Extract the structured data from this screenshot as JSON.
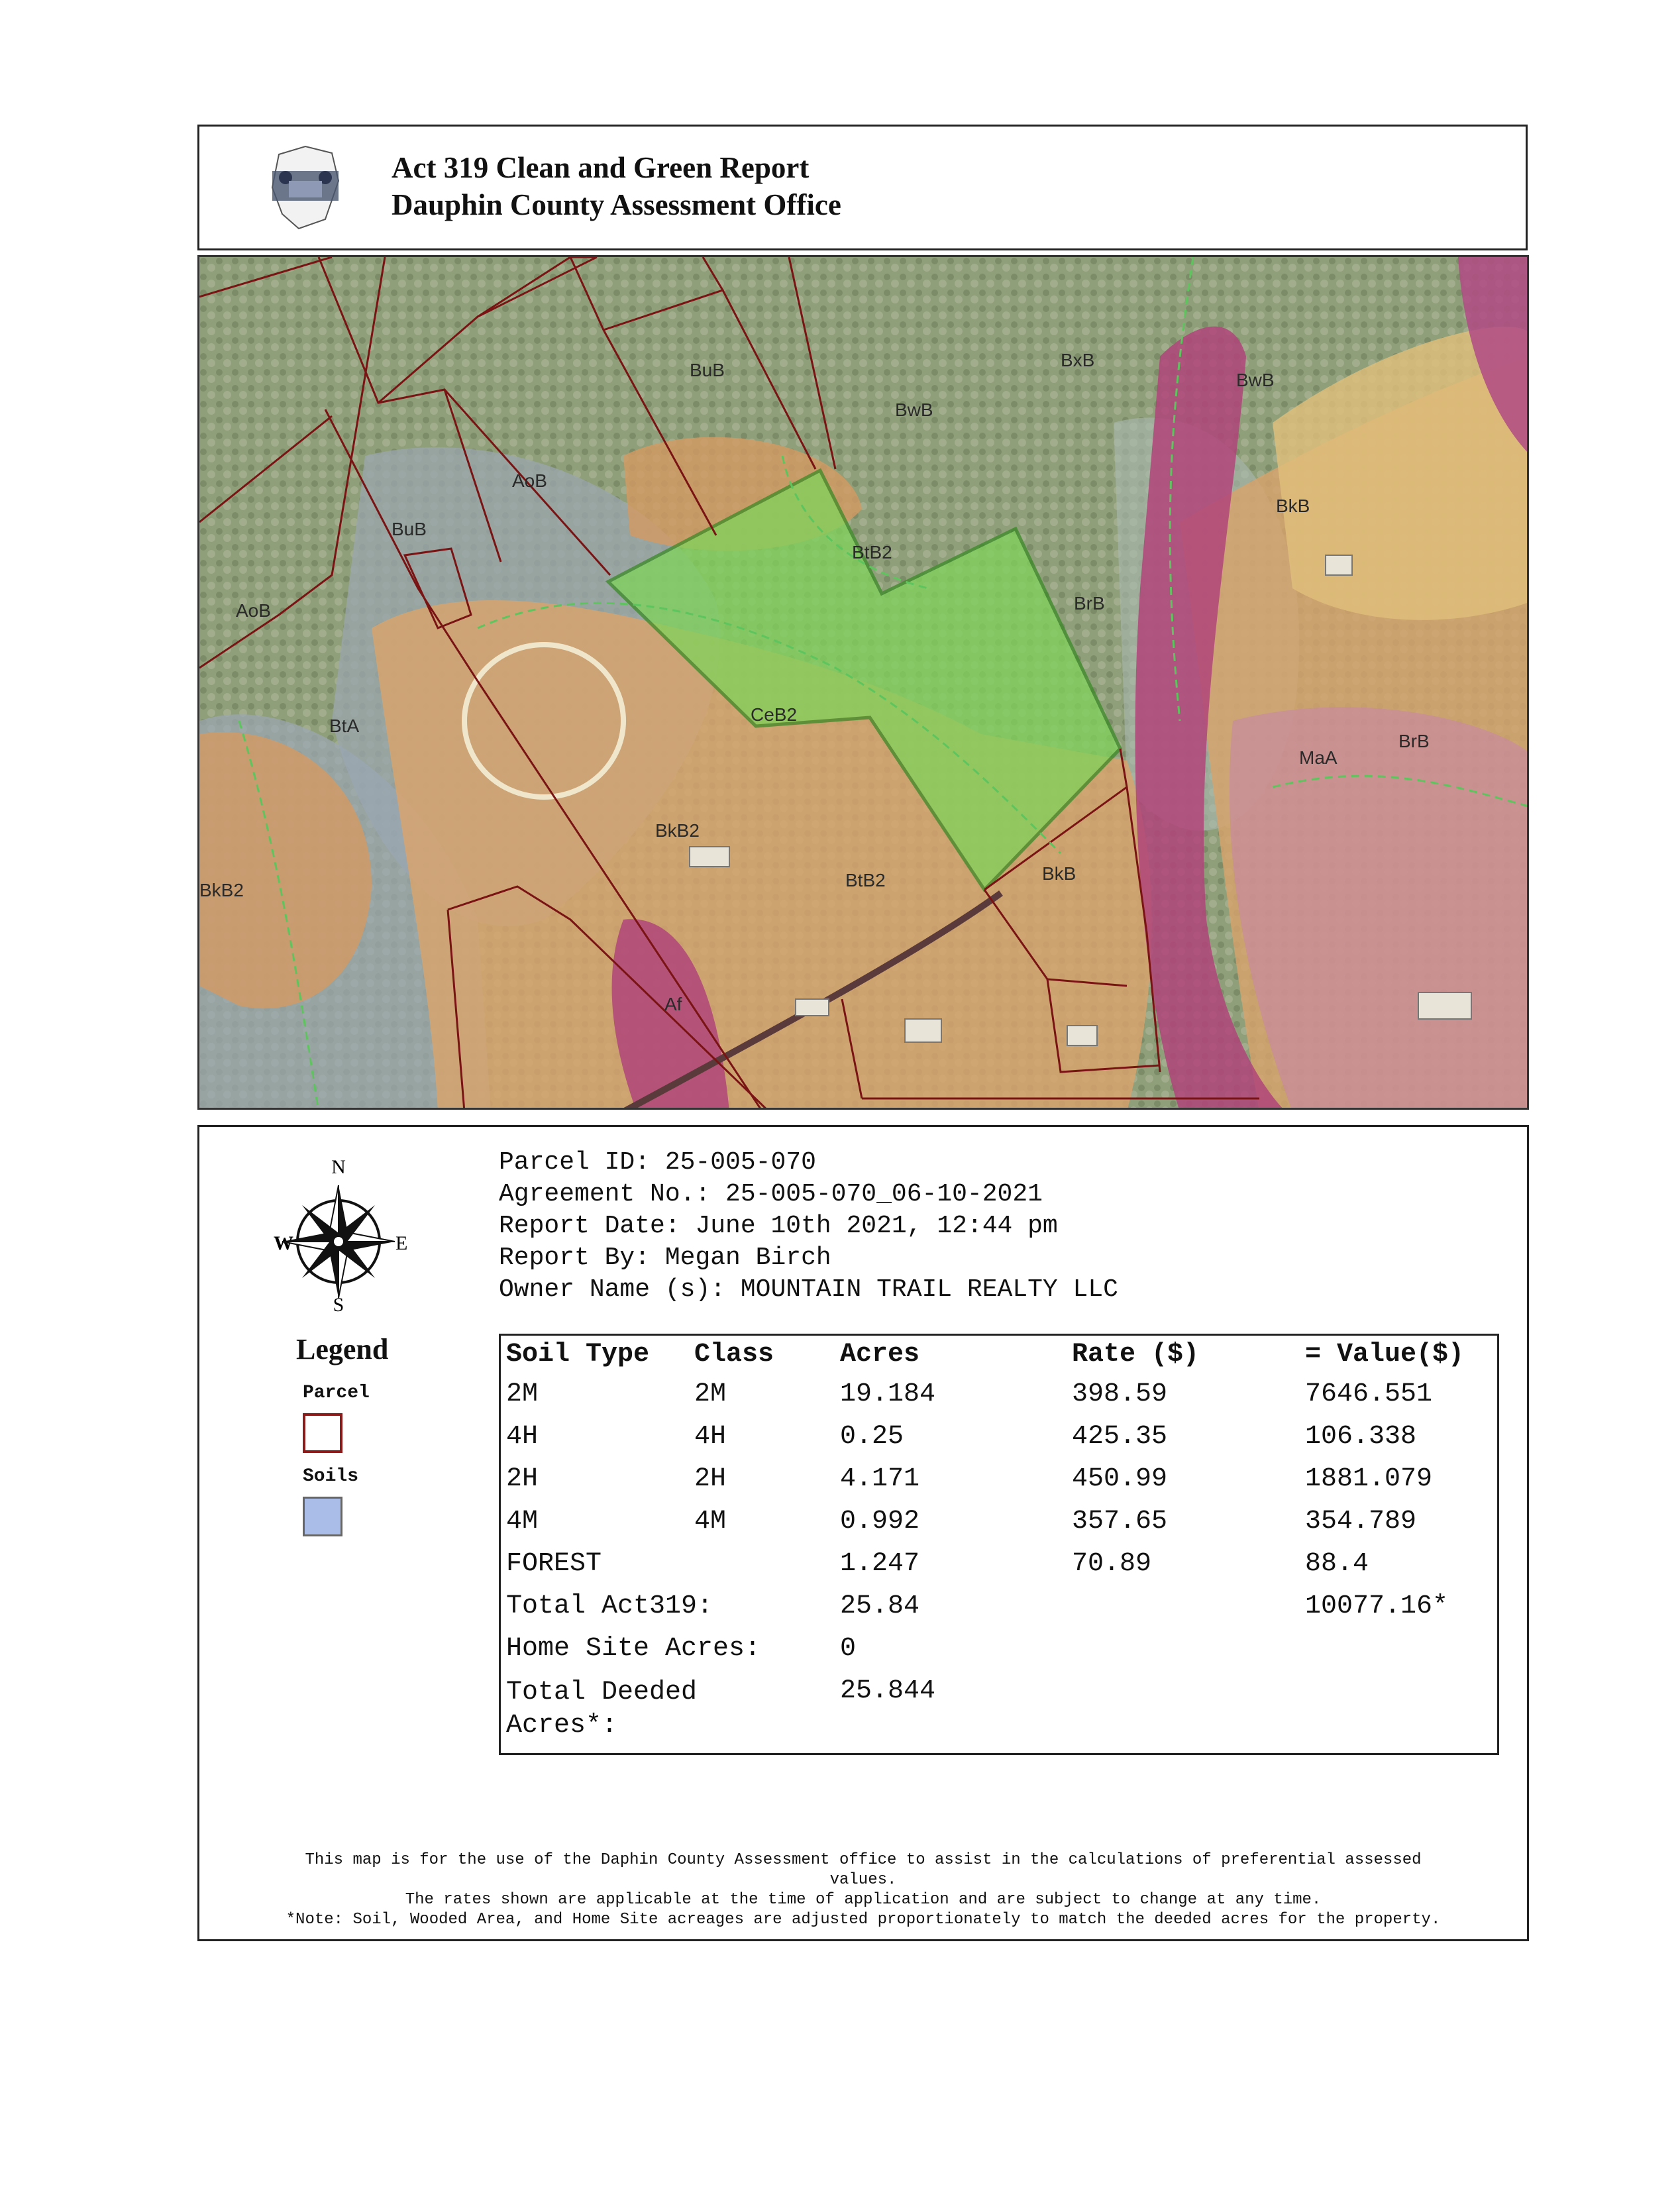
{
  "header": {
    "title": "Act 319 Clean and Green Report",
    "office": "Dauphin County Assessment Office"
  },
  "map": {
    "soil_labels": [
      "BuB",
      "BxB",
      "BwB",
      "BwB",
      "AoB",
      "BuB",
      "BtB2",
      "BkB",
      "AoB",
      "BrB",
      "BtA",
      "CeB2",
      "MaA",
      "BrB",
      "BkB2",
      "BkB2",
      "BtB2",
      "BkB",
      "Af"
    ]
  },
  "compass": {
    "n": "N",
    "s": "S",
    "e": "E",
    "w": "W"
  },
  "info": {
    "parcel_id": "Parcel ID: 25-005-070",
    "agreement": "Agreement No.: 25-005-070_06-10-2021",
    "report_date": "Report Date: June 10th 2021, 12:44 pm",
    "report_by": "Report By: Megan Birch",
    "owner": "Owner Name (s): MOUNTAIN TRAIL REALTY LLC"
  },
  "legend": {
    "title": "Legend",
    "parcel": "Parcel",
    "soils": "Soils",
    "parcel_color": "#8b1a1a",
    "soils_color": "#a9bde8"
  },
  "table": {
    "headers": [
      "Soil Type",
      "Class",
      "Acres",
      "Rate ($)",
      "= Value($)"
    ],
    "rows": [
      [
        "2M",
        "2M",
        "19.184",
        "398.59",
        "7646.551"
      ],
      [
        "4H",
        "4H",
        "0.25",
        "425.35",
        "106.338"
      ],
      [
        "2H",
        "2H",
        "4.171",
        "450.99",
        "1881.079"
      ],
      [
        "4M",
        "4M",
        "0.992",
        "357.65",
        "354.789"
      ],
      [
        "FOREST",
        "",
        "1.247",
        "70.89",
        "88.4"
      ]
    ],
    "total_label": "Total Act319:",
    "total_acres": "25.84",
    "total_value": "10077.16*",
    "home_label": "Home Site Acres:",
    "home_acres": "0",
    "deeded_label_1": "Total Deeded",
    "deeded_label_2": "Acres*:",
    "deeded_acres": "25.844"
  },
  "footer": {
    "line1": "This map is for the use of the Daphin County Assessment office to assist in the calculations of preferential assessed",
    "line2": "values.",
    "line3": "The rates shown are applicable at the time of application and are subject to change at any time.",
    "line4": "*Note: Soil, Wooded Area, and Home Site acreages are adjusted proportionately to match the deeded acres for the property."
  }
}
